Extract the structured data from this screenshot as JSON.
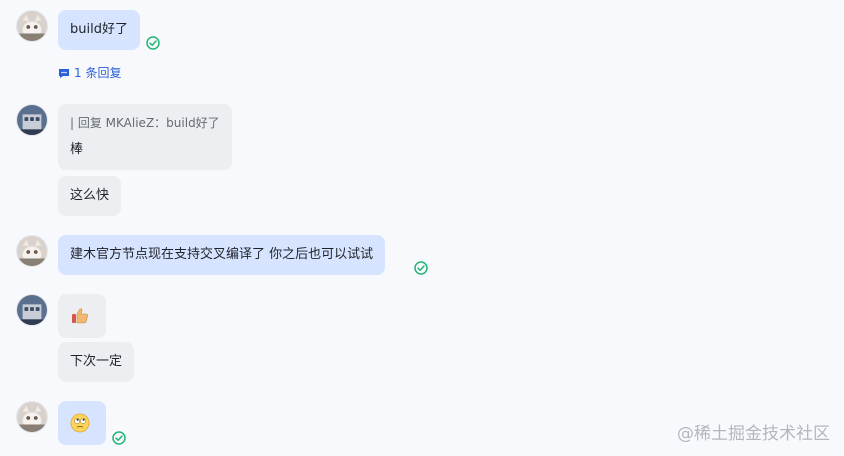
{
  "messages": [
    {
      "text": "build好了"
    },
    {
      "reply_count": "1 条回复"
    },
    {
      "quote_prefix": "| 回复 MKAlieZ：",
      "quote_text": "build好了",
      "text": "棒"
    },
    {
      "text": "这么快"
    },
    {
      "text": "建木官方节点现在支持交叉编译了 你之后也可以试试"
    },
    {
      "emoji": "thumbs-up-emoji"
    },
    {
      "text": "下次一定"
    },
    {
      "emoji": "rolling-eyes-emoji"
    }
  ],
  "watermark": "@稀土掘金技术社区",
  "colors": {
    "mine_bubble": "#d6e4ff",
    "theirs_bubble": "#eceef1",
    "read_check": "#22b573",
    "link": "#2b5fd9"
  }
}
